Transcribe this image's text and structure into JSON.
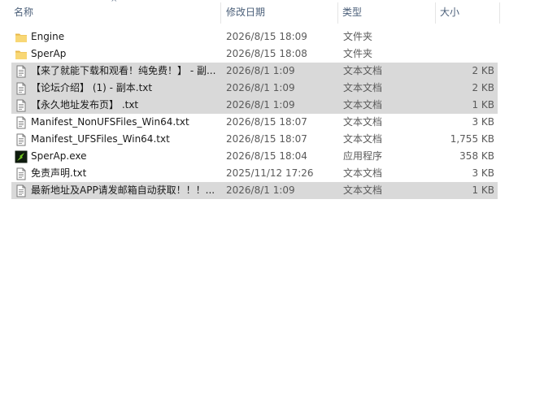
{
  "header": {
    "name": "名称",
    "date": "修改日期",
    "type": "类型",
    "size": "大小",
    "sort_arrow": "^"
  },
  "files": [
    {
      "name": "Engine",
      "date": "2026/8/15 18:09",
      "type": "文件夹",
      "size": "",
      "icon": "folder-icon",
      "selected": false
    },
    {
      "name": "SperAp",
      "date": "2026/8/15 18:08",
      "type": "文件夹",
      "size": "",
      "icon": "folder-icon",
      "selected": false
    },
    {
      "name": "【来了就能下载和观看！纯免费！】 - 副...",
      "date": "2026/8/1 1:09",
      "type": "文本文档",
      "size": "2 KB",
      "icon": "text-file-icon",
      "selected": true
    },
    {
      "name": "【论坛介绍】 (1) - 副本.txt",
      "date": "2026/8/1 1:09",
      "type": "文本文档",
      "size": "2 KB",
      "icon": "text-file-icon",
      "selected": true
    },
    {
      "name": "【永久地址发布页】 .txt",
      "date": "2026/8/1 1:09",
      "type": "文本文档",
      "size": "1 KB",
      "icon": "text-file-icon",
      "selected": true
    },
    {
      "name": "Manifest_NonUFSFiles_Win64.txt",
      "date": "2026/8/15 18:07",
      "type": "文本文档",
      "size": "3 KB",
      "icon": "text-file-icon",
      "selected": false
    },
    {
      "name": "Manifest_UFSFiles_Win64.txt",
      "date": "2026/8/15 18:07",
      "type": "文本文档",
      "size": "1,755 KB",
      "icon": "text-file-icon",
      "selected": false
    },
    {
      "name": "SperAp.exe",
      "date": "2026/8/15 18:04",
      "type": "应用程序",
      "size": "358 KB",
      "icon": "exe-app-icon",
      "selected": false
    },
    {
      "name": "免责声明.txt",
      "date": "2025/11/12 17:26",
      "type": "文本文档",
      "size": "3 KB",
      "icon": "text-file-icon",
      "selected": false
    },
    {
      "name": "最新地址及APP请发邮箱自动获取！！！...",
      "date": "2026/8/1 1:09",
      "type": "文本文档",
      "size": "1 KB",
      "icon": "text-file-icon",
      "selected": true
    }
  ]
}
